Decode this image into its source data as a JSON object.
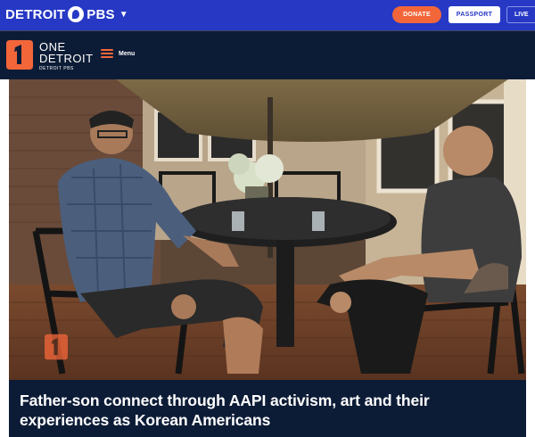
{
  "pbs_bar": {
    "station_name": "DETROIT",
    "network": "PBS",
    "caret_icon": "chevron-down-icon",
    "donate_label": "DONATE",
    "passport_label": "PASSPORT",
    "live_label": "LIVE",
    "colors": {
      "bar": "#2638c4",
      "donate": "#f2663a"
    }
  },
  "site_header": {
    "logo_line1": "ONE",
    "logo_line2": "DETROIT",
    "logo_sub": "DETROIT PBS",
    "menu_label": "Menu",
    "menu_icon": "hamburger-icon",
    "colors": {
      "bar": "#0d1c36",
      "accent": "#f2663a"
    }
  },
  "hero": {
    "image_description": "hero-photo",
    "watermark_icon": "one-detroit-logo-icon"
  },
  "article": {
    "title": "Father-son connect through AAPI activism, art and their experiences as Korean Americans"
  }
}
